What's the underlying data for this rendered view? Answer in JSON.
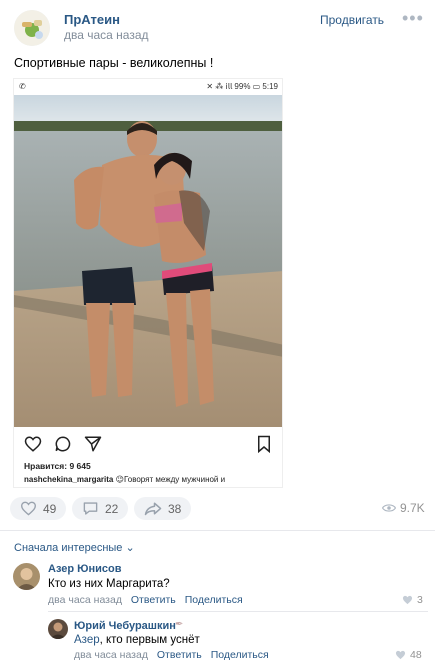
{
  "post": {
    "group_name": "ПрАтеин",
    "time": "два часа назад",
    "promote_label": "Продвигать",
    "more_label": "•••",
    "text": "Спортивные пары - великолепны !"
  },
  "embedded_screenshot": {
    "status_left": "✆",
    "status_right": "✕ ⁂ 𝗂𝗅𝗅 99% ▭ 5:19",
    "likes_text": "Нравится: 9 645",
    "caption_user": "nashchekina_margarita",
    "caption_text": "😉Говорят между мужчиной и"
  },
  "actions": {
    "likes": "49",
    "comments": "22",
    "shares": "38",
    "views": "9.7K"
  },
  "comments_section": {
    "sort_label": "Сначала интересные ⌄",
    "comments": [
      {
        "author": "Азер Юнисов",
        "text": "Кто из них Маргарита?",
        "time": "два часа назад",
        "reply_label": "Ответить",
        "share_label": "Поделиться",
        "likes": "3"
      },
      {
        "author": "Юрий Чебурашкин",
        "text": "Азер, кто первым уснёт",
        "time": "два часа назад",
        "reply_label": "Ответить",
        "share_label": "Поделиться",
        "likes": "48"
      }
    ]
  },
  "colors": {
    "link_blue": "#2a5885",
    "muted_gray": "#818c99",
    "pill_bg": "#f0f2f5"
  }
}
